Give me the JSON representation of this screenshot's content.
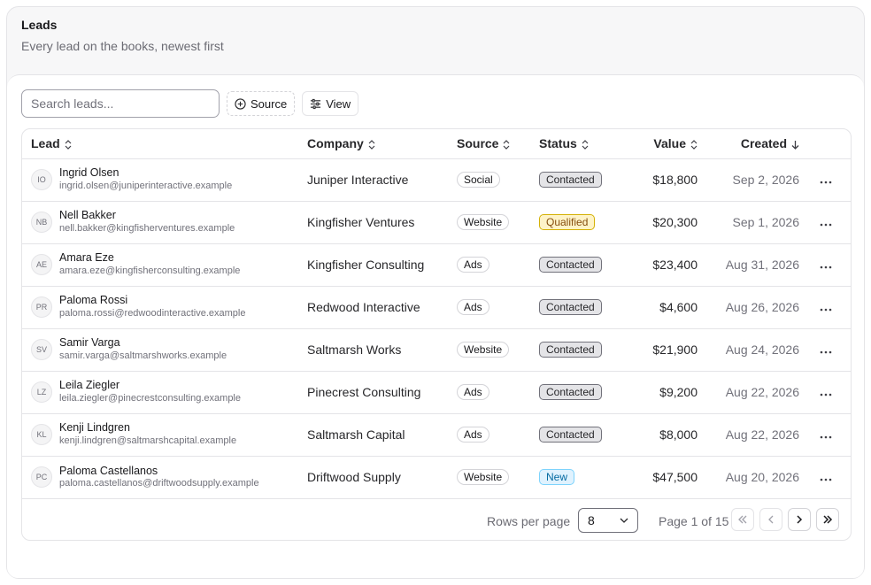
{
  "header": {
    "title": "Leads",
    "subtitle": "Every lead on the books, newest first"
  },
  "toolbar": {
    "search_placeholder": "Search leads...",
    "source_label": "Source",
    "view_label": "View"
  },
  "columns": {
    "lead": "Lead",
    "company": "Company",
    "source": "Source",
    "status": "Status",
    "value": "Value",
    "created": "Created"
  },
  "rows": [
    {
      "initials": "IO",
      "name": "Ingrid Olsen",
      "email": "ingrid.olsen@juniperinteractive.example",
      "company": "Juniper Interactive",
      "source": "Social",
      "status": "Contacted",
      "status_kind": "contacted",
      "value": "$18,800",
      "created": "Sep 2, 2026"
    },
    {
      "initials": "NB",
      "name": "Nell Bakker",
      "email": "nell.bakker@kingfisherventures.example",
      "company": "Kingfisher Ventures",
      "source": "Website",
      "status": "Qualified",
      "status_kind": "qualified",
      "value": "$20,300",
      "created": "Sep 1, 2026"
    },
    {
      "initials": "AE",
      "name": "Amara Eze",
      "email": "amara.eze@kingfisherconsulting.example",
      "company": "Kingfisher Consulting",
      "source": "Ads",
      "status": "Contacted",
      "status_kind": "contacted",
      "value": "$23,400",
      "created": "Aug 31, 2026"
    },
    {
      "initials": "PR",
      "name": "Paloma Rossi",
      "email": "paloma.rossi@redwoodinteractive.example",
      "company": "Redwood Interactive",
      "source": "Ads",
      "status": "Contacted",
      "status_kind": "contacted",
      "value": "$4,600",
      "created": "Aug 26, 2026"
    },
    {
      "initials": "SV",
      "name": "Samir Varga",
      "email": "samir.varga@saltmarshworks.example",
      "company": "Saltmarsh Works",
      "source": "Website",
      "status": "Contacted",
      "status_kind": "contacted",
      "value": "$21,900",
      "created": "Aug 24, 2026"
    },
    {
      "initials": "LZ",
      "name": "Leila Ziegler",
      "email": "leila.ziegler@pinecrestconsulting.example",
      "company": "Pinecrest Consulting",
      "source": "Ads",
      "status": "Contacted",
      "status_kind": "contacted",
      "value": "$9,200",
      "created": "Aug 22, 2026"
    },
    {
      "initials": "KL",
      "name": "Kenji Lindgren",
      "email": "kenji.lindgren@saltmarshcapital.example",
      "company": "Saltmarsh Capital",
      "source": "Ads",
      "status": "Contacted",
      "status_kind": "contacted",
      "value": "$8,000",
      "created": "Aug 22, 2026"
    },
    {
      "initials": "PC",
      "name": "Paloma Castellanos",
      "email": "paloma.castellanos@driftwoodsupply.example",
      "company": "Driftwood Supply",
      "source": "Website",
      "status": "New",
      "status_kind": "new",
      "value": "$47,500",
      "created": "Aug 20, 2026"
    }
  ],
  "pagination": {
    "rows_per_page_label": "Rows per page",
    "rows_per_page_value": "8",
    "page_info": "Page 1 of 15"
  },
  "icons": {
    "sort": "chevrons-up-down-icon",
    "sort_desc": "arrow-down-icon",
    "more": "more-horizontal-icon"
  }
}
